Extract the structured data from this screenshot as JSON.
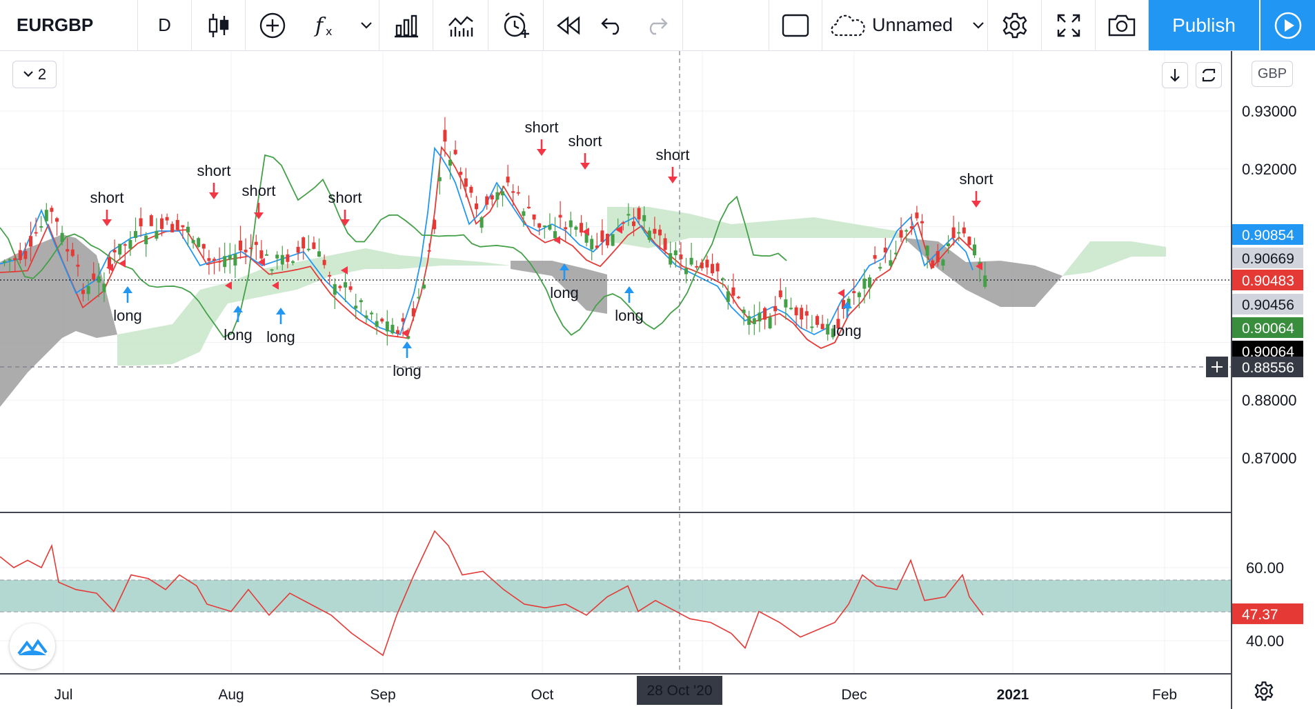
{
  "toolbar": {
    "symbol": "EURGBP",
    "interval": "D",
    "layout_name": "Unnamed",
    "publish_label": "Publish"
  },
  "pane": {
    "collapse_count": "2",
    "currency": "GBP"
  },
  "price_axis": {
    "ticks": [
      "0.93000",
      "0.92000",
      "0.88000",
      "0.87000"
    ],
    "indicator_ticks": [
      "60.00",
      "40.00"
    ]
  },
  "price_tags": [
    {
      "label": "0.90854",
      "bg": "#2196f3",
      "fg": "#ffffff"
    },
    {
      "label": "0.90669",
      "bg": "#d1d4dc",
      "fg": "#131722"
    },
    {
      "label": "0.90483",
      "bg": "#e53935",
      "fg": "#ffffff"
    },
    {
      "label": "0.90456",
      "bg": "#d1d4dc",
      "fg": "#131722"
    },
    {
      "label": "0.90064",
      "bg": "#388e3c",
      "fg": "#ffffff"
    },
    {
      "label": "0.90064",
      "bg": "#000000",
      "fg": "#ffffff"
    },
    {
      "label": "0.88556",
      "bg": "#363a45",
      "fg": "#ffffff"
    }
  ],
  "rsi_tag": {
    "label": "47.37",
    "bg": "#e53935",
    "fg": "#ffffff"
  },
  "time_axis": {
    "labels": [
      "Jul",
      "Aug",
      "Sep",
      "Oct",
      "Dec",
      "2021",
      "Feb"
    ],
    "crosshair_label": "28 Oct '20"
  },
  "signals": [
    {
      "type": "short",
      "label": "short"
    },
    {
      "type": "long",
      "label": "long"
    },
    {
      "type": "short",
      "label": "short"
    },
    {
      "type": "long",
      "label": "long"
    },
    {
      "type": "short",
      "label": "short"
    },
    {
      "type": "long",
      "label": "long"
    },
    {
      "type": "short",
      "label": "short"
    },
    {
      "type": "long",
      "label": "long"
    },
    {
      "type": "short",
      "label": "short"
    },
    {
      "type": "short",
      "label": "short"
    },
    {
      "type": "long",
      "label": "long"
    },
    {
      "type": "long",
      "label": "long"
    },
    {
      "type": "short",
      "label": "short"
    },
    {
      "type": "long",
      "label": "long"
    },
    {
      "type": "short",
      "label": "short"
    }
  ],
  "colors": {
    "candle_up": "#43a047",
    "candle_down": "#e53935",
    "tenkan": "#2196f3",
    "kijun": "#e53935",
    "chikou": "#43a047",
    "kumo_bull": "#c8e6c9",
    "kumo_bear": "#9e9e9e",
    "rsi_band": "#80bdb3",
    "rsi_line": "#e53935",
    "long_arrow": "#2196f3",
    "short_arrow": "#f23645"
  },
  "icons": [
    "candles-icon",
    "add-indicator-icon",
    "fx-icon",
    "chevron-down-icon",
    "compare-icon",
    "indicators-icon",
    "alert-icon",
    "replay-icon",
    "undo-icon",
    "redo-icon",
    "rectangle-icon",
    "cloud-icon",
    "settings-icon",
    "fullscreen-icon",
    "camera-icon",
    "play-icon",
    "arrow-down-icon",
    "auto-icon",
    "logo-icon",
    "gear-icon"
  ]
}
